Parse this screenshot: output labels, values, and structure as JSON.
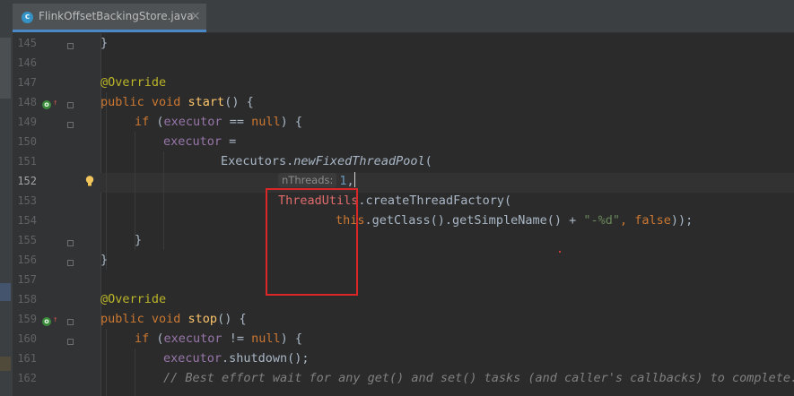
{
  "tab": {
    "icon_letter": "c",
    "file_name": "FlinkOffsetBackingStore.java",
    "close_glyph": "×"
  },
  "gutter": {
    "line_numbers": [
      "145",
      "146",
      "147",
      "148",
      "149",
      "150",
      "151",
      "152",
      "153",
      "154",
      "155",
      "156",
      "157",
      "158",
      "159",
      "160",
      "161",
      "162"
    ],
    "current_line": "152"
  },
  "code": {
    "l145": "}",
    "l147": "@Override",
    "l148": {
      "kw": "public void ",
      "name": "start",
      "rest": "() {"
    },
    "l149": {
      "kw": "if ",
      "open": "(",
      "field": "executor",
      "op": " == ",
      "kw2": "null",
      "rest": ") {"
    },
    "l150": {
      "field": "executor",
      "rest": " ="
    },
    "l151": {
      "cls": "Executors.",
      "method": "newFixedThreadPool",
      "rest": "("
    },
    "l152": {
      "hint": "nThreads:",
      "num": "1",
      "rest": ","
    },
    "l153": {
      "err": "ThreadUtils",
      "rest": ".createThreadFactory("
    },
    "l154": {
      "kw": "this",
      "mid": ".getClass().getSimpleName() + ",
      "str": "\"-%d\"",
      "sep": ", ",
      "kw2": "false",
      "rest": "));"
    },
    "l155": "}",
    "l156": "}",
    "l158": "@Override",
    "l159": {
      "kw": "public void ",
      "name": "stop",
      "rest": "() {"
    },
    "l160": {
      "kw": "if ",
      "open": "(",
      "field": "executor",
      "op": " != ",
      "kw2": "null",
      "rest": ") {"
    },
    "l161": {
      "field": "executor",
      "rest": ".shutdown();"
    },
    "l162": "// Best effort wait for any get() and set() tasks (and caller's callbacks) to complete."
  },
  "colors": {
    "background": "#2b2b2b",
    "keyword": "#cc7832",
    "annotation": "#bbb529",
    "method_decl": "#ffc66d",
    "field": "#9876aa",
    "number": "#6897bb",
    "string": "#6a8759",
    "comment": "#808080",
    "unresolved": "#e06c6c",
    "highlight_box": "#d92626"
  },
  "icons": {
    "tab_file": "java-class-icon",
    "gutter_override": "override-method-icon",
    "intention": "lightbulb-icon"
  }
}
